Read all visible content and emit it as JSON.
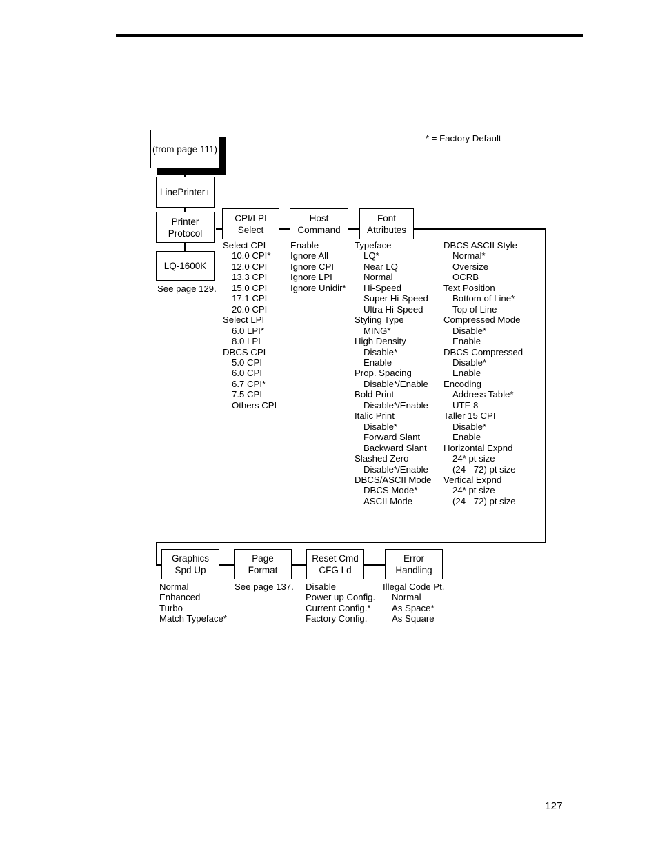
{
  "page": {
    "number": "127",
    "legend": "* = Factory Default"
  },
  "boxes": {
    "from_page": "(from page 111)",
    "lineprinter": "LinePrinter+",
    "printer_protocol": {
      "line1": "Printer",
      "line2": "Protocol"
    },
    "lq1600k": "LQ-1600K",
    "cpi_lpi_select": {
      "line1": "CPI/LPI",
      "line2": "Select"
    },
    "host_command": {
      "line1": "Host",
      "line2": "Command"
    },
    "font_attributes": {
      "line1": "Font",
      "line2": "Attributes"
    },
    "graphics_spd_up": {
      "line1": "Graphics",
      "line2": "Spd Up"
    },
    "page_format": {
      "line1": "Page",
      "line2": "Format"
    },
    "reset_cmd_cfg_ld": {
      "line1": "Reset Cmd",
      "line2": "CFG Ld"
    },
    "error_handling": {
      "line1": "Error",
      "line2": "Handling"
    }
  },
  "notes": {
    "see_page_129": "See page 129.",
    "see_page_137": "See page 137."
  },
  "columns": {
    "cpi_lpi_select": [
      {
        "text": "Select CPI",
        "indent": 0
      },
      {
        "text": "10.0 CPI*",
        "indent": 1
      },
      {
        "text": "12.0 CPI",
        "indent": 1
      },
      {
        "text": "13.3 CPI",
        "indent": 1
      },
      {
        "text": "15.0 CPI",
        "indent": 1
      },
      {
        "text": "17.1 CPI",
        "indent": 1
      },
      {
        "text": "20.0 CPI",
        "indent": 1
      },
      {
        "text": "Select LPI",
        "indent": 0
      },
      {
        "text": "6.0 LPI*",
        "indent": 1
      },
      {
        "text": "8.0 LPI",
        "indent": 1
      },
      {
        "text": "DBCS CPI",
        "indent": 0
      },
      {
        "text": "5.0 CPI",
        "indent": 1
      },
      {
        "text": "6.0 CPI",
        "indent": 1
      },
      {
        "text": "6.7 CPI*",
        "indent": 1
      },
      {
        "text": "7.5 CPI",
        "indent": 1
      },
      {
        "text": "Others CPI",
        "indent": 1
      }
    ],
    "host_command": [
      {
        "text": "Enable",
        "indent": 0
      },
      {
        "text": "Ignore All",
        "indent": 0
      },
      {
        "text": "Ignore CPI",
        "indent": 0
      },
      {
        "text": "Ignore LPI",
        "indent": 0
      },
      {
        "text": "Ignore Unidir*",
        "indent": 0
      }
    ],
    "font_attributes": [
      {
        "text": "Typeface",
        "indent": 0
      },
      {
        "text": "LQ*",
        "indent": 1
      },
      {
        "text": "Near LQ",
        "indent": 1
      },
      {
        "text": "Normal",
        "indent": 1
      },
      {
        "text": "Hi-Speed",
        "indent": 1
      },
      {
        "text": "Super Hi-Speed",
        "indent": 1
      },
      {
        "text": "Ultra Hi-Speed",
        "indent": 1
      },
      {
        "text": "Styling Type",
        "indent": 0
      },
      {
        "text": "MING*",
        "indent": 1
      },
      {
        "text": "High Density",
        "indent": 0
      },
      {
        "text": "Disable*",
        "indent": 1
      },
      {
        "text": "Enable",
        "indent": 1
      },
      {
        "text": "Prop. Spacing",
        "indent": 0
      },
      {
        "text": "Disable*/Enable",
        "indent": 1
      },
      {
        "text": "Bold Print",
        "indent": 0
      },
      {
        "text": "Disable*/Enable",
        "indent": 1
      },
      {
        "text": "Italic Print",
        "indent": 0
      },
      {
        "text": "Disable*",
        "indent": 1
      },
      {
        "text": "Forward Slant",
        "indent": 1
      },
      {
        "text": "Backward Slant",
        "indent": 1
      },
      {
        "text": "Slashed Zero",
        "indent": 0
      },
      {
        "text": "Disable*/Enable",
        "indent": 1
      },
      {
        "text": "DBCS/ASCII Mode",
        "indent": 0
      },
      {
        "text": "DBCS Mode*",
        "indent": 1
      },
      {
        "text": "ASCII Mode",
        "indent": 1
      }
    ],
    "font_attributes_2": [
      {
        "text": "DBCS ASCII Style",
        "indent": 0
      },
      {
        "text": "Normal*",
        "indent": 1
      },
      {
        "text": "Oversize",
        "indent": 1
      },
      {
        "text": "OCRB",
        "indent": 1
      },
      {
        "text": "Text Position",
        "indent": 0
      },
      {
        "text": "Bottom of Line*",
        "indent": 1
      },
      {
        "text": "Top of Line",
        "indent": 1
      },
      {
        "text": "Compressed Mode",
        "indent": 0
      },
      {
        "text": "Disable*",
        "indent": 1
      },
      {
        "text": "Enable",
        "indent": 1
      },
      {
        "text": "DBCS Compressed",
        "indent": 0
      },
      {
        "text": "Disable*",
        "indent": 1
      },
      {
        "text": "Enable",
        "indent": 1
      },
      {
        "text": "Encoding",
        "indent": 0
      },
      {
        "text": "Address Table*",
        "indent": 1
      },
      {
        "text": "UTF-8",
        "indent": 1
      },
      {
        "text": "Taller 15 CPI",
        "indent": 0
      },
      {
        "text": "Disable*",
        "indent": 1
      },
      {
        "text": "Enable",
        "indent": 1
      },
      {
        "text": "Horizontal Expnd",
        "indent": 0
      },
      {
        "text": "24* pt size",
        "indent": 1
      },
      {
        "text": "(24 - 72) pt size",
        "indent": 1
      },
      {
        "text": "Vertical Expnd",
        "indent": 0
      },
      {
        "text": "24* pt size",
        "indent": 1
      },
      {
        "text": "(24 - 72) pt size",
        "indent": 1
      }
    ],
    "graphics_spd_up": [
      {
        "text": "Normal",
        "indent": 0
      },
      {
        "text": "Enhanced",
        "indent": 0
      },
      {
        "text": "Turbo",
        "indent": 0
      },
      {
        "text": "Match Typeface*",
        "indent": 0
      }
    ],
    "reset_cmd_cfg_ld": [
      {
        "text": "Disable",
        "indent": 0
      },
      {
        "text": "Power up Config.",
        "indent": 0
      },
      {
        "text": "Current Config.*",
        "indent": 0
      },
      {
        "text": "Factory Config.",
        "indent": 0
      }
    ],
    "error_handling": [
      {
        "text": "Illegal Code Pt.",
        "indent": 0
      },
      {
        "text": "Normal",
        "indent": 1
      },
      {
        "text": "As Space*",
        "indent": 1
      },
      {
        "text": "As Square",
        "indent": 1
      }
    ]
  }
}
